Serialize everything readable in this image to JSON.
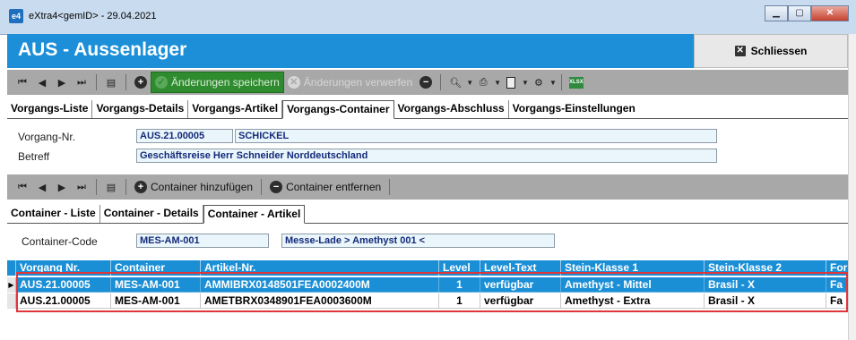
{
  "window": {
    "title": "eXtra4<gemID>  -  29.04.2021",
    "app_icon": "e4",
    "minimize": "▁",
    "maximize": "▢",
    "close": "✕"
  },
  "header": {
    "title": "AUS - Aussenlager",
    "close_label": "Schliessen"
  },
  "toolbar1": {
    "save_label": "Änderungen speichern",
    "discard_label": "Änderungen verwerfen"
  },
  "tabs1": [
    {
      "label": "Vorgangs-Liste"
    },
    {
      "label": "Vorgangs-Details"
    },
    {
      "label": "Vorgangs-Artikel"
    },
    {
      "label": "Vorgangs-Container"
    },
    {
      "label": "Vorgangs-Abschluss"
    },
    {
      "label": "Vorgangs-Einstellungen"
    }
  ],
  "form": {
    "vorgang_label": "Vorgang-Nr.",
    "vorgang_nr": "AUS.21.00005",
    "vorgang_name": "SCHICKEL",
    "betreff_label": "Betreff",
    "betreff": "Geschäftsreise Herr Schneider Norddeutschland"
  },
  "toolbar2": {
    "add_label": "Container hinzufügen",
    "remove_label": "Container entfernen"
  },
  "tabs2": [
    {
      "label": "Container - Liste"
    },
    {
      "label": "Container - Details"
    },
    {
      "label": "Container - Artikel"
    }
  ],
  "container": {
    "code_label": "Container-Code",
    "code": "MES-AM-001",
    "description": "Messe-Lade  > Amethyst 001 <"
  },
  "grid": {
    "columns": [
      "Vorgang Nr.",
      "Container",
      "Artikel-Nr.",
      "Level",
      "Level-Text",
      "Stein-Klasse 1",
      "Stein-Klasse 2",
      "For"
    ],
    "rows": [
      [
        "AUS.21.00005",
        "MES-AM-001",
        "AMMIBRX0148501FEA0002400M",
        "1",
        "verfügbar",
        "Amethyst - Mittel",
        "Brasil - X",
        "Fa"
      ],
      [
        "AUS.21.00005",
        "MES-AM-001",
        "AMETBRX0348901FEA0003600M",
        "1",
        "verfügbar",
        "Amethyst - Extra",
        "Brasil - X",
        "Fa"
      ]
    ],
    "selected_row": 0,
    "row_marker": "▶"
  },
  "colors": {
    "accent": "#1c8fd8",
    "toolbar": "#a8a8a8",
    "save_green": "#2e8b2e",
    "highlight_red": "#e0353a"
  }
}
